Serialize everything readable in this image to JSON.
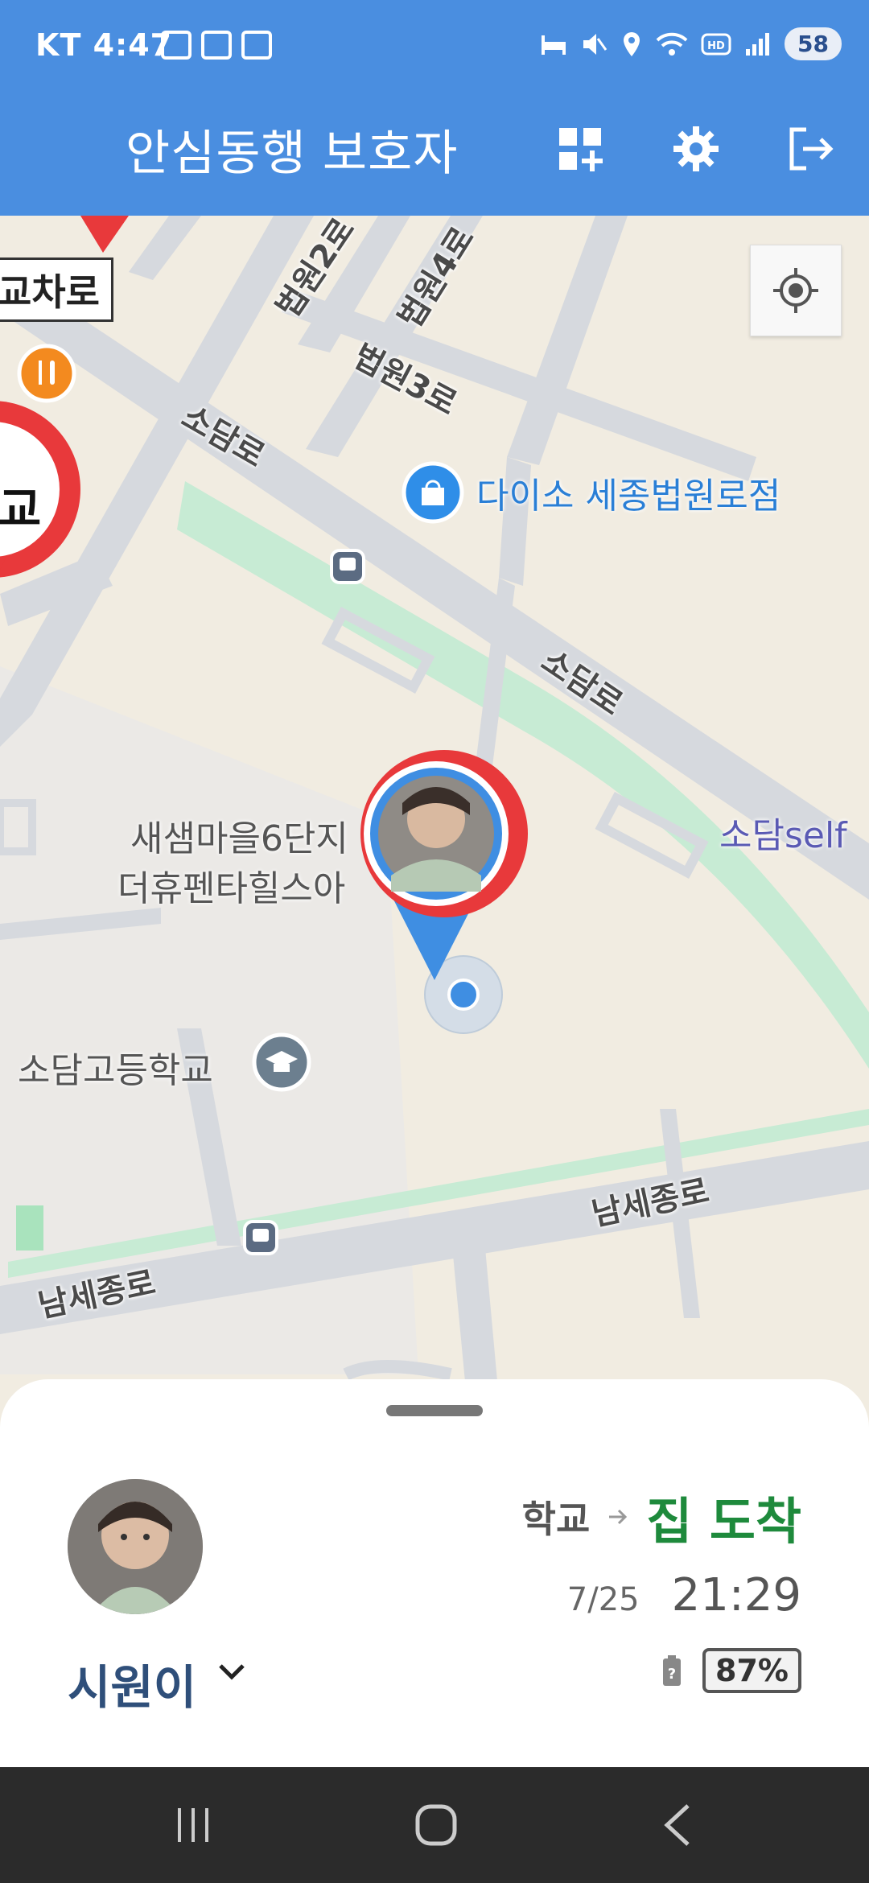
{
  "status_bar": {
    "carrier_time": "KT 4:47",
    "battery": "58"
  },
  "app_bar": {
    "title": "안심동행 보호자"
  },
  "map": {
    "roads": {
      "beobwon2": "법원2로",
      "beobwon4": "법원4로",
      "beobwon3": "법원3로",
      "sodam_1": "소담로",
      "sodam_2": "소담로",
      "namsejong_1": "남세종로",
      "namsejong_2": "남세종로"
    },
    "tag": "교차로",
    "school_marker_label": "교",
    "pois": {
      "daiso": "다이소 세종법원로점",
      "apartment_line1": "새샘마을6단지",
      "apartment_line2": "더휴펜타힐스아",
      "sodam_self": "소담self",
      "highschool": "소담고등학교"
    },
    "colors": {
      "road": "#d6d9de",
      "green": "#c7ebd4",
      "marker_blue": "#3f8ee2",
      "marker_red": "#e8393b"
    }
  },
  "sheet": {
    "child_name": "시원이",
    "route_from": "학교",
    "route_to": "집 도착",
    "date": "7/25",
    "time": "21:29",
    "battery": "87%"
  }
}
